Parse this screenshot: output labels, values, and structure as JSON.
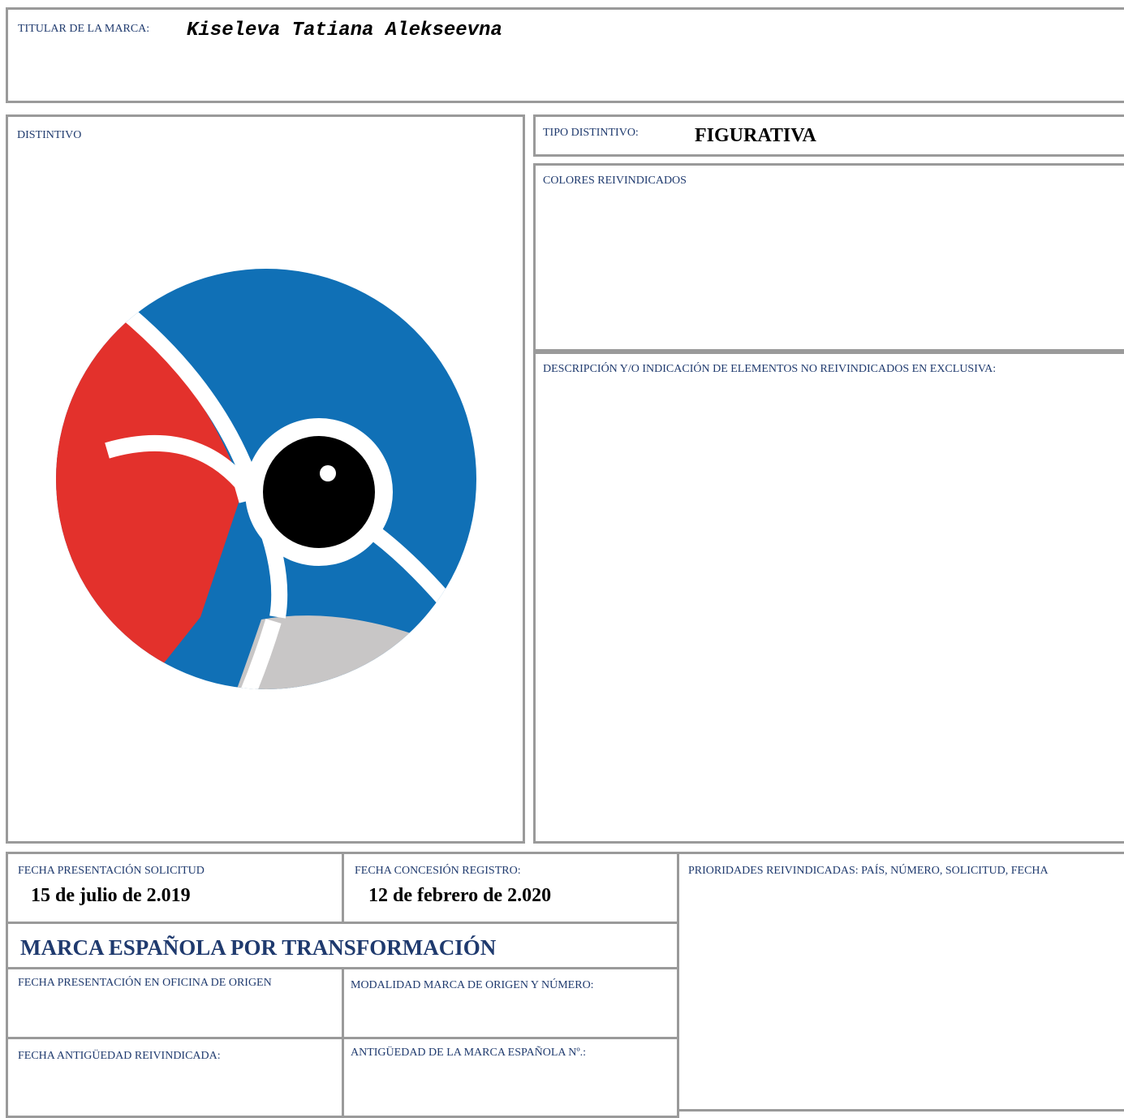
{
  "header": {
    "titular_label": "TITULAR DE LA MARCA:",
    "titular_value": "Kiseleva Tatiana Alekseevna"
  },
  "distintivo": {
    "label": "DISTINTIVO",
    "logo_colors": {
      "blue": "#1070b6",
      "red": "#e3312c",
      "grey": "#c8c6c6",
      "pupil": "#000000"
    }
  },
  "tipo": {
    "label": "TIPO DISTINTIVO:",
    "value": "FIGURATIVA"
  },
  "colores": {
    "label": "COLORES REIVINDICADOS"
  },
  "descripcion": {
    "label": "DESCRIPCIÓN Y/O INDICACIÓN DE ELEMENTOS NO REIVINDICADOS EN EXCLUSIVA:"
  },
  "fechas": {
    "presentacion_label": "FECHA PRESENTACIÓN SOLICITUD",
    "presentacion_value": "15 de julio de 2.019",
    "concesion_label": "FECHA CONCESIÓN REGISTRO:",
    "concesion_value": "12 de febrero de 2.020"
  },
  "prioridades": {
    "label": "PRIORIDADES REIVINDICADAS: PAÍS, NÚMERO, SOLICITUD, FECHA"
  },
  "transformacion": {
    "title": "MARCA ESPAÑOLA POR TRANSFORMACIÓN",
    "fecha_origen_label": "FECHA PRESENTACIÓN EN OFICINA DE ORIGEN",
    "modalidad_label": "MODALIDAD MARCA DE ORIGEN Y NÚMERO:",
    "antiguedad_fecha_label": "FECHA ANTIGÜEDAD REIVINDICADA:",
    "antiguedad_num_label": "ANTIGÜEDAD DE LA MARCA ESPAÑOLA Nº.:"
  },
  "colors": {
    "border": "#9a9a9a",
    "label_text": "#1f3a6e"
  }
}
